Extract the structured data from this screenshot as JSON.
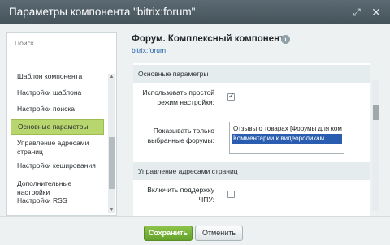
{
  "window": {
    "title": "Параметры компонента \"bitrix:forum\"",
    "expand_icon": "expand-icon",
    "close_icon": "close-icon"
  },
  "sidebar": {
    "search_placeholder": "Поиск",
    "items": [
      {
        "label": "Шаблон компонента",
        "active": false
      },
      {
        "label": "Настройки шаблона",
        "active": false
      },
      {
        "label": "Настройки поиска",
        "active": false
      },
      {
        "label": "Основные параметры",
        "active": true
      },
      {
        "label": "Управление адресами страниц",
        "active": false
      },
      {
        "label": "Настройки кеширования",
        "active": false
      },
      {
        "label": "Дополнительные настройки",
        "active": false
      },
      {
        "label": "Настройки RSS",
        "active": false
      }
    ]
  },
  "component": {
    "title": "Форум. Комплексный компонент",
    "info_icon": "info-icon",
    "code": "bitrix:forum"
  },
  "sections": [
    {
      "title": "Основные параметры"
    },
    {
      "title": "Управление адресами страниц"
    }
  ],
  "params": {
    "simple_mode": {
      "label": "Использовать простой режим настройки:",
      "checked": true
    },
    "show_forums": {
      "label": "Показывать только выбранные форумы:",
      "options": [
        {
          "label": "Отзывы о товарах [Форумы для комме",
          "selected": false
        },
        {
          "label": "Комментарии к видеороликам.",
          "selected": true
        }
      ]
    },
    "sef": {
      "label": "Включить поддержку ЧПУ:",
      "checked": false
    }
  },
  "footer": {
    "save_label": "Сохранить",
    "cancel_label": "Отменить"
  },
  "colors": {
    "titlebar": "#4f5c64",
    "active_item": "#b8d66e",
    "save_button": "#74ae36",
    "selected_option": "#2a5db0"
  }
}
